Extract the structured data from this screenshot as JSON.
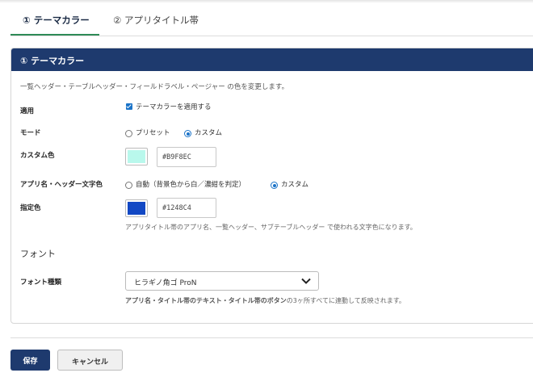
{
  "tabs": [
    {
      "label": "① テーマカラー",
      "active": true
    },
    {
      "label": "② アプリタイトル帯",
      "active": false
    }
  ],
  "panel": {
    "title": "① テーマカラー",
    "description": "一覧ヘッダー・テーブルヘッダー・フィールドラベル・ページャー の色を変更します。"
  },
  "apply": {
    "label": "適用",
    "checkbox_label": "テーマカラーを適用する",
    "checked": true
  },
  "mode": {
    "label": "モード",
    "options": [
      "プリセット",
      "カスタム"
    ],
    "selected": "カスタム"
  },
  "custom_color": {
    "label": "カスタム色",
    "hex": "#B9F8EC"
  },
  "header_text_color": {
    "label": "アプリ名・ヘッダー文字色",
    "options": [
      "自動（背景色から白／濃紺を判定）",
      "カスタム"
    ],
    "selected": "カスタム"
  },
  "specified_color": {
    "label": "指定色",
    "hex": "#1248C4",
    "help": "アプリタイトル帯のアプリ名、一覧ヘッダー、サブテーブルヘッダー で使われる文字色になります。"
  },
  "font_section": {
    "title": "フォント"
  },
  "font_type": {
    "label": "フォント種類",
    "selected": "ヒラギノ角ゴ ProN",
    "help_bold": "アプリ名・タイトル帯のテキスト・タイトル帯のボタン",
    "help_rest": "の3ヶ所すべてに連動して反映されます。"
  },
  "actions": {
    "save": "保存",
    "cancel": "キャンセル"
  },
  "colors": {
    "header_bg": "#1E3A6E",
    "tab_underline": "#2E8B57",
    "accent": "#1A73C8",
    "save_button": "#1E3A6E"
  }
}
